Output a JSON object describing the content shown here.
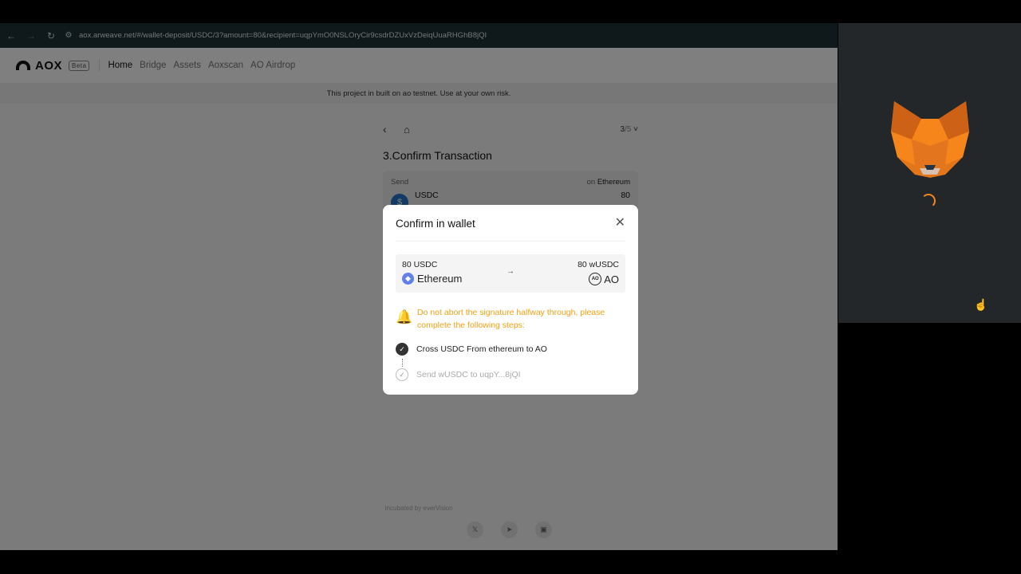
{
  "browser": {
    "url": "aox.arweave.net/#/wallet-deposit/USDC/3?amount=80&recipient=uqpYmO0NSLOryCir9csdrDZUxVzDeiqUuaRHGhB8jQI",
    "back_icon": "arrow-left-icon",
    "forward_icon": "arrow-right-icon",
    "reload_icon": "reload-icon"
  },
  "site": {
    "logo_text": "AOX",
    "beta_label": "Beta",
    "nav": [
      "Home",
      "Bridge",
      "Assets",
      "Aoxscan",
      "AO Airdrop"
    ],
    "banner": "This project in built on ao testnet. Use at your own risk.",
    "step_current": "3",
    "step_total": "/5",
    "page_title": "3.Confirm Transaction",
    "send_card": {
      "label": "Send",
      "on_prefix": "on",
      "chain": "Ethereum",
      "token": "USDC",
      "amount": "80"
    },
    "footer_text": "Incubated by everVision",
    "socials": [
      "twitter-icon",
      "telegram-icon",
      "discord-icon"
    ]
  },
  "modal": {
    "title": "Confirm in wallet",
    "close_icon": "close-icon",
    "from_amount": "80 USDC",
    "from_chain": "Ethereum",
    "arrow": "→",
    "to_amount": "80 wUSDC",
    "to_chain": "AO",
    "warning": "Do not abort the signature halfway through, please complete the following steps:",
    "warning_color": "#f0a015",
    "steps": [
      {
        "label": "Cross USDC From ethereum to AO",
        "status": "done"
      },
      {
        "label": "Send wUSDC to uqpY...8jQI",
        "status": "pending"
      }
    ]
  },
  "metamask": {
    "logo_icon": "metamask-fox-icon",
    "loading_icon": "spinner-icon",
    "accent": "#f6851b"
  }
}
